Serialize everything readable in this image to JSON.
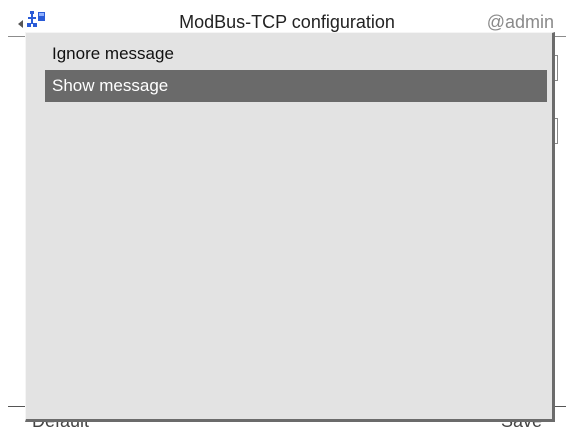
{
  "header": {
    "title": "ModBus-TCP configuration",
    "user": "@admin",
    "back_icon": "back-arrow-icon",
    "network_icon": "network-icon"
  },
  "footer": {
    "left_label": "Default",
    "right_label": "Save"
  },
  "popup": {
    "options": [
      {
        "label": "Ignore message",
        "selected": false
      },
      {
        "label": "Show message",
        "selected": true
      }
    ],
    "colors": {
      "background": "#e3e3e3",
      "selected_background": "#6a6a6a",
      "selected_text": "#ffffff"
    }
  }
}
